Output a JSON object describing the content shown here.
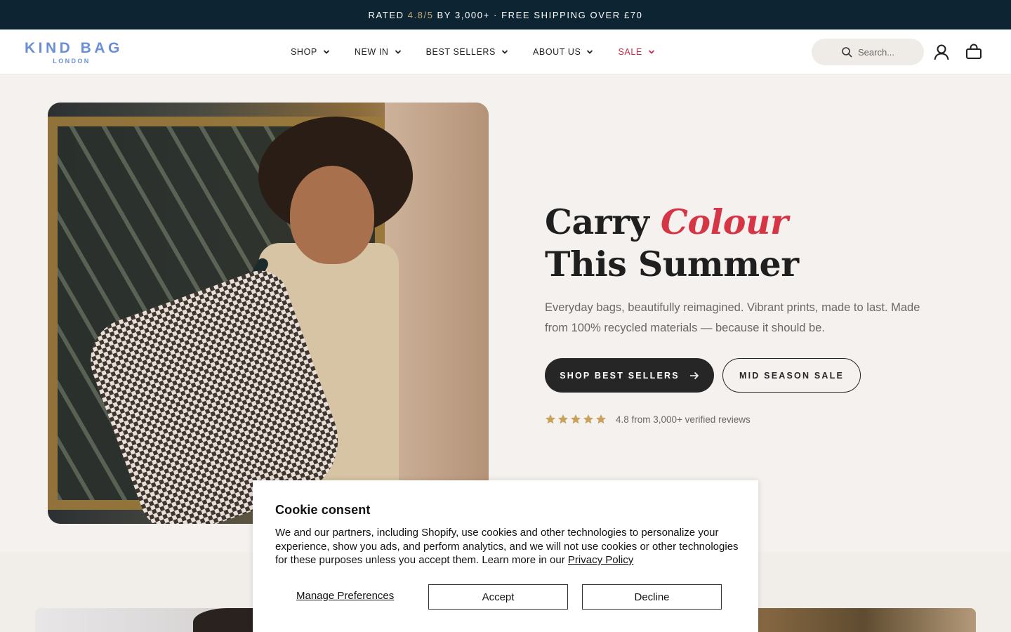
{
  "announcement": {
    "prefix": "RATED",
    "rating": "4.8/5",
    "suffix": "BY 3,000+ · FREE SHIPPING OVER £70"
  },
  "header": {
    "logo_main": "KIND BAG",
    "logo_sub": "LONDON",
    "nav": [
      {
        "label": "SHOP"
      },
      {
        "label": "NEW IN"
      },
      {
        "label": "BEST SELLERS"
      },
      {
        "label": "ABOUT US"
      },
      {
        "label": "SALE"
      }
    ],
    "search_placeholder": "Search...",
    "icons": [
      "search-icon",
      "account-icon",
      "cart-icon",
      "chevron-down-icon"
    ]
  },
  "hero": {
    "title_line1_plain": "Carry",
    "title_line1_accent": "Colour",
    "title_line2": "This Summer",
    "subtitle": "Everyday bags, beautifully reimagined. Vibrant prints, made to last. Made from 100% recycled materials — because it should be.",
    "primary_button": "SHOP BEST SELLERS",
    "secondary_button": "MID SEASON SALE",
    "star_count": 5,
    "rating_text": "4.8 from 3,000+ verified reviews"
  },
  "cookie": {
    "title": "Cookie consent",
    "body": "We and our partners, including Shopify, use cookies and other technologies to personalize your experience, show you ads, and perform analytics, and we will not use cookies or other technologies for these purposes unless you accept them. Learn more in our",
    "link": "Privacy Policy",
    "manage": "Manage Preferences",
    "accept": "Accept",
    "decline": "Decline"
  },
  "colors": {
    "announcement_bg": "#0d2433",
    "logo": "#6a8fd8",
    "sale": "#c62a49",
    "accent": "#d53545",
    "star": "#c9a25c",
    "button_dark": "#272626"
  }
}
